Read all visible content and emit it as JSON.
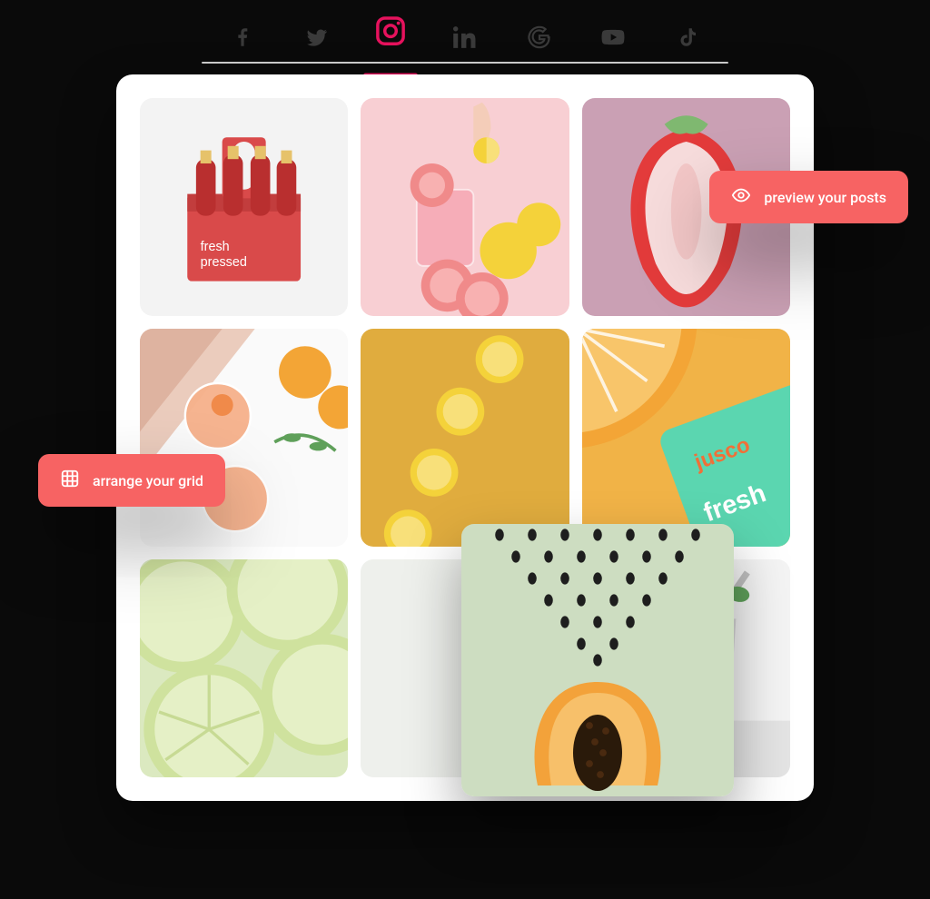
{
  "colors": {
    "accent": "#f76363",
    "instagram": "#e6125d",
    "icon_grey": "#3a3a3a"
  },
  "tabs": {
    "active_index": 2,
    "items": [
      {
        "name": "facebook",
        "semantic": "facebook-icon"
      },
      {
        "name": "twitter",
        "semantic": "twitter-icon"
      },
      {
        "name": "instagram",
        "semantic": "instagram-icon"
      },
      {
        "name": "linkedin",
        "semantic": "linkedin-icon"
      },
      {
        "name": "google",
        "semantic": "google-icon"
      },
      {
        "name": "youtube",
        "semantic": "youtube-icon"
      },
      {
        "name": "tiktok",
        "semantic": "tiktok-icon"
      }
    ]
  },
  "callouts": {
    "arrange": {
      "label": "arrange your grid",
      "icon": "grid-icon"
    },
    "preview": {
      "label": "preview your posts",
      "icon": "eye-icon"
    }
  },
  "grid": {
    "tiles": [
      {
        "desc": "red juice bottle six-pack carrier on white"
      },
      {
        "desc": "hand, grapefruit slices, lemons, pink drink on pink"
      },
      {
        "desc": "strawberry cross-section on mauve"
      },
      {
        "desc": "peach cocktails, oranges, linen, mint on white flat-lay"
      },
      {
        "desc": "lemon slices on mustard yellow"
      },
      {
        "desc": "orange slice with teal jusco popsicle packaging on yellow"
      },
      {
        "desc": "lime slices macro, pale green"
      },
      {
        "desc": "empty slot behind floating tile"
      },
      {
        "desc": "green smoothie in textured glass with straw and mint"
      }
    ],
    "floating_tile": {
      "desc": "papaya half with seeds scattering on sage green",
      "over_index": 7
    }
  }
}
